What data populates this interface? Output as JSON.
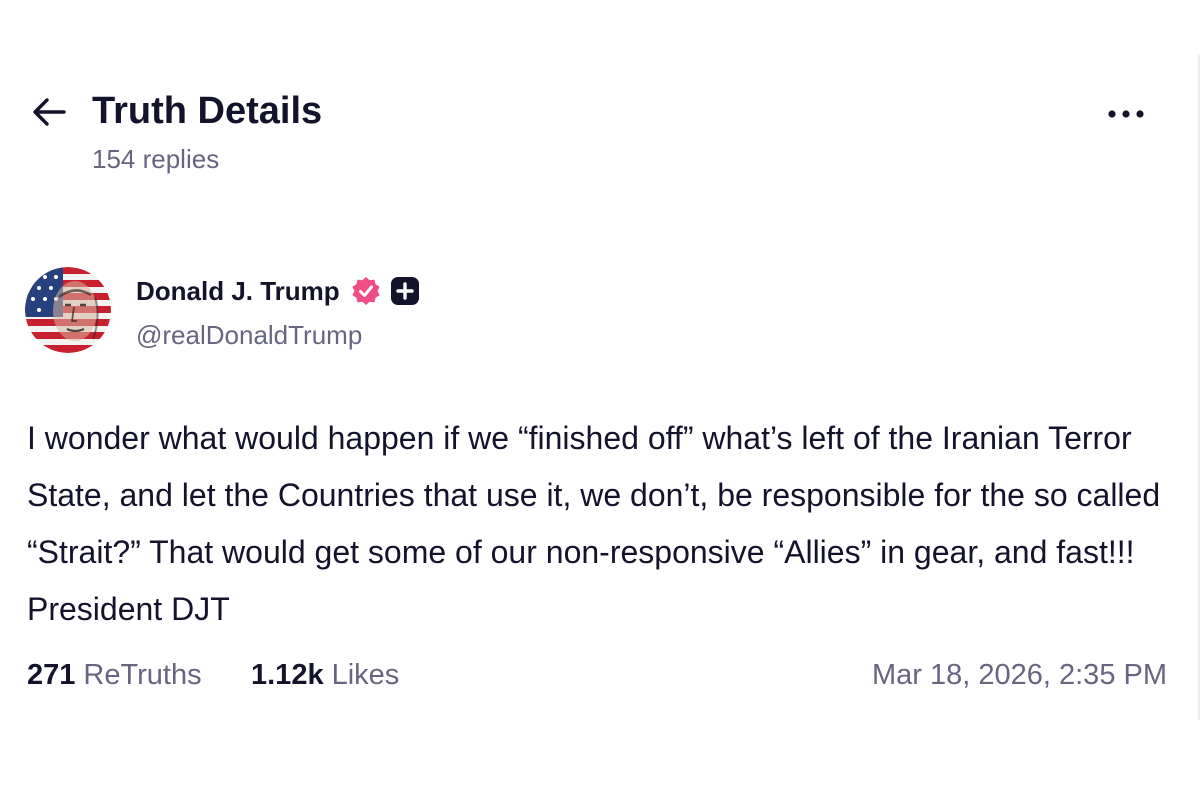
{
  "header": {
    "title": "Truth Details",
    "reply_count": "154 replies",
    "back_icon": "arrow-left-icon",
    "more_icon": "more-horizontal-icon"
  },
  "author": {
    "display_name": "Donald J. Trump",
    "handle": "@realDonaldTrump",
    "verified_icon": "verified-badge-icon",
    "plus_icon": "plus-badge-icon",
    "verified_color": "#ee4d86"
  },
  "post": {
    "text": "I wonder what would happen if we “finished off” what’s left of the Iranian Terror State, and let the Countries that use it, we don’t, be responsible for the so called “Strait?” That would get some of our non-responsive “Allies” in gear, and fast!!! President DJT"
  },
  "stats": {
    "retruths_count": "271",
    "retruths_label": "ReTruths",
    "likes_count": "1.12k",
    "likes_label": "Likes",
    "timestamp": "Mar 18, 2026, 2:35 PM"
  },
  "colors": {
    "text_primary": "#13132b",
    "text_secondary": "#666680",
    "background": "#ffffff"
  }
}
